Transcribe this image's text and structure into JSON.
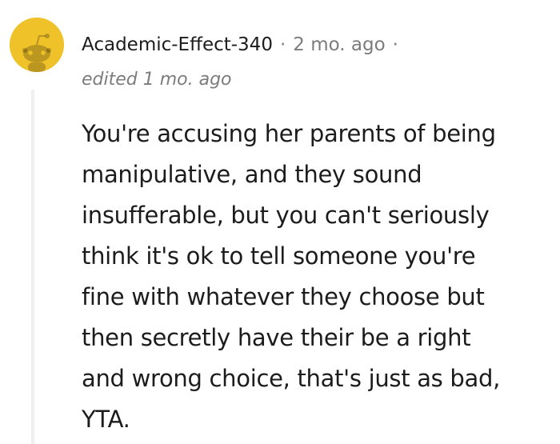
{
  "comment": {
    "author": "Academic-Effect-340",
    "separator": "·",
    "timestamp": "2 mo. ago",
    "edited": "edited 1 mo. ago",
    "avatar_icon": "reddit-snoo-avatar-icon",
    "avatar_color": "#f0c22a",
    "body_lines": [
      "You're accusing her parents of being",
      "manipulative, and they sound",
      "insufferable, but you can't seriously",
      "think it's ok to tell someone you're",
      "fine with whatever they choose but",
      "then secretly have their be a right",
      "and wrong choice, that's just as bad,",
      "YTA."
    ]
  }
}
